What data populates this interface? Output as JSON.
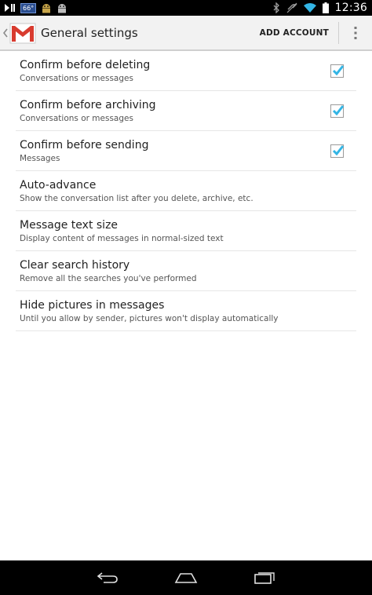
{
  "status_bar": {
    "temperature": "66°",
    "time": "12:36",
    "icons": [
      "media-play-pause-icon",
      "weather-icon",
      "android-debug-icon",
      "android-icon",
      "bluetooth-icon",
      "mute-icon",
      "wifi-icon",
      "battery-icon"
    ]
  },
  "action_bar": {
    "title": "General settings",
    "add_account_label": "ADD ACCOUNT",
    "icons": [
      "up-caret-icon",
      "gmail-logo-icon",
      "overflow-menu-icon"
    ]
  },
  "settings": {
    "items": [
      {
        "title": "Confirm before deleting",
        "summary": "Conversations or messages",
        "checked": true
      },
      {
        "title": "Confirm before archiving",
        "summary": "Conversations or messages",
        "checked": true
      },
      {
        "title": "Confirm before sending",
        "summary": "Messages",
        "checked": true
      },
      {
        "title": "Auto-advance",
        "summary": "Show the conversation list after you delete, archive, etc."
      },
      {
        "title": "Message text size",
        "summary": "Display content of messages in normal-sized text"
      },
      {
        "title": "Clear search history",
        "summary": "Remove all the searches you've performed"
      },
      {
        "title": "Hide pictures in messages",
        "summary": "Until you allow by sender, pictures won't display automatically"
      }
    ]
  },
  "nav_bar": {
    "icons": [
      "back-icon",
      "home-icon",
      "recent-apps-icon"
    ]
  },
  "colors": {
    "accent": "#33b5e5",
    "status_bar_bg": "#000000",
    "action_bar_bg": "#f2f2f2",
    "divider": "#e6e6e6"
  }
}
